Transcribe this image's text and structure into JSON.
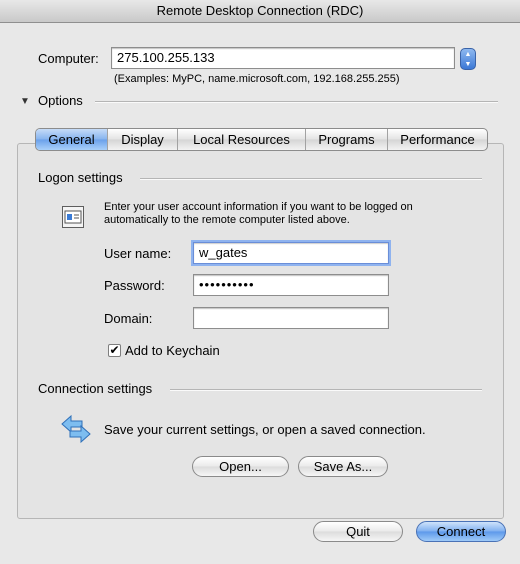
{
  "window": {
    "title": "Remote Desktop Connection (RDC)"
  },
  "computer": {
    "label": "Computer:",
    "value": "275.100.255.133",
    "examples": "(Examples: MyPC, name.microsoft.com, 192.168.255.255)"
  },
  "options": {
    "label": "Options"
  },
  "tabs": [
    {
      "label": "General"
    },
    {
      "label": "Display"
    },
    {
      "label": "Local Resources"
    },
    {
      "label": "Programs"
    },
    {
      "label": "Performance"
    }
  ],
  "logon": {
    "section_title": "Logon settings",
    "info_text": "Enter your user account information if you want to be logged on automatically to the remote computer listed above.",
    "username_label": "User name:",
    "username_value": "w_gates",
    "password_label": "Password:",
    "password_value": "••••••••••",
    "domain_label": "Domain:",
    "domain_value": "",
    "keychain_label": "Add to Keychain",
    "keychain_checked": "✔"
  },
  "connection": {
    "section_title": "Connection settings",
    "info_text": "Save your current settings, or open a saved connection.",
    "open_label": "Open...",
    "saveas_label": "Save As..."
  },
  "footer": {
    "quit_label": "Quit",
    "connect_label": "Connect"
  },
  "colors": {
    "accent": "#6aa0ea",
    "window_bg": "#e8e8e8"
  }
}
